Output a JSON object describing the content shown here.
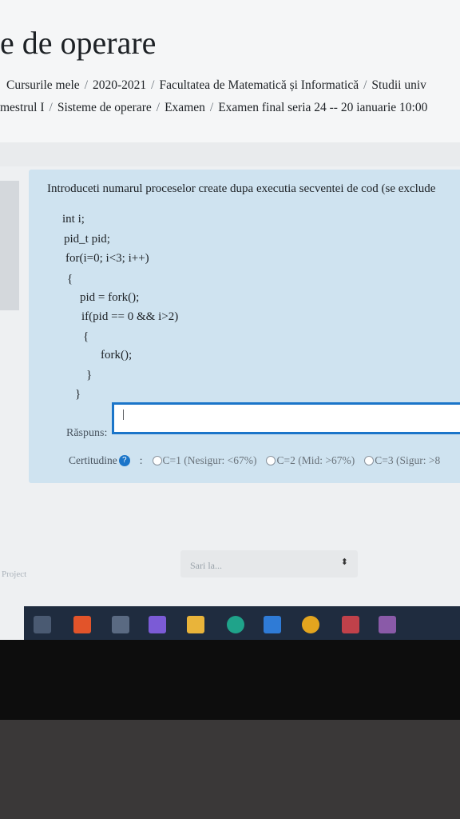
{
  "course_title": "e de operare",
  "breadcrumb_line1": [
    "Cursurile mele",
    "2020-2021",
    "Facultatea de Matematică și Informatică",
    "Studii univ"
  ],
  "breadcrumb_line2": [
    "mestrul I",
    "Sisteme de operare",
    "Examen",
    "Examen final seria 24 -- 20 ianuarie 10:00"
  ],
  "question": {
    "text": "Introduceti numarul proceselor create dupa executia secventei de cod (se exclude",
    "code": [
      "int i;",
      "pid_t pid;",
      "for(i=0; i<3; i++)",
      "{",
      "pid = fork();",
      "if(pid == 0 && i>2)",
      "{",
      "fork();",
      "}",
      "}"
    ]
  },
  "answer": {
    "label": "Răspuns:",
    "value": "|"
  },
  "certitude": {
    "label": "Certitudine",
    "options": [
      "C=1 (Nesigur: <67%)",
      "C=2 (Mid: >67%)",
      "C=3 (Sigur: >8"
    ]
  },
  "footer": {
    "project": "Project",
    "jump_label": "Sari la...",
    "jump_arrow": "⬍"
  },
  "taskbar_icons": [
    "task-view",
    "office",
    "store",
    "visual-studio",
    "file-explorer",
    "edge",
    "vs-code",
    "chrome",
    "media",
    "app"
  ],
  "colors": {
    "accent": "#1b75c9",
    "question_bg": "#cfe3f0",
    "taskbar": "#1f2c3f"
  }
}
